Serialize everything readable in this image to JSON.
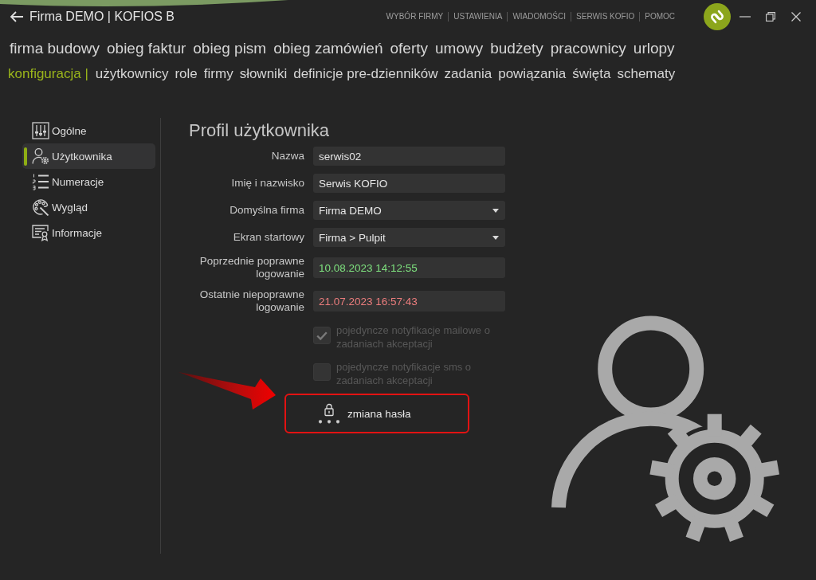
{
  "window": {
    "title": "Firma DEMO | KOFIOS B"
  },
  "top_links": [
    "WYBÓR FIRMY",
    "USTAWIENIA",
    "WIADOMOŚCI",
    "SERWIS KOFIO",
    "POMOC"
  ],
  "modules": [
    "firma budowy",
    "obieg faktur",
    "obieg pism",
    "obieg zamówień",
    "oferty",
    "umowy",
    "budżety",
    "pracownicy",
    "urlopy"
  ],
  "submenu": {
    "current": "konfiguracja |",
    "items": [
      "użytkownicy",
      "role",
      "firmy",
      "słowniki",
      "definicje pre-dzienników",
      "zadania",
      "powiązania",
      "święta",
      "schematy"
    ]
  },
  "sidebar": {
    "items": [
      {
        "label": "Ogólne",
        "selected": false
      },
      {
        "label": "Użytkownika",
        "selected": true
      },
      {
        "label": "Numeracje",
        "selected": false
      },
      {
        "label": "Wygląd",
        "selected": false
      },
      {
        "label": "Informacje",
        "selected": false
      }
    ]
  },
  "form": {
    "title": "Profil użytkownika",
    "fields": [
      {
        "label": "Nazwa",
        "value": "serwis02",
        "kind": "input"
      },
      {
        "label": "Imię i nazwisko",
        "value": "Serwis KOFIO",
        "kind": "input"
      },
      {
        "label": "Domyślna firma",
        "value": "Firma DEMO",
        "kind": "select"
      },
      {
        "label": "Ekran startowy",
        "value": "Firma > Pulpit",
        "kind": "select"
      },
      {
        "label": "Poprzednie poprawne logowanie",
        "value": "10.08.2023 14:12:55",
        "kind": "readonly",
        "color": "#7ee07e"
      },
      {
        "label": "Ostatnie niepoprawne logowanie",
        "value": "21.07.2023 16:57:43",
        "kind": "readonly",
        "color": "#ec7d7d"
      }
    ],
    "options": [
      {
        "label": "pojedyncze notyfikacje mailowe o zadaniach akceptacji",
        "checked": true,
        "disabled": true
      },
      {
        "label": "pojedyncze notyfikacje sms o zadaniach akceptacji",
        "checked": false,
        "disabled": true
      }
    ]
  },
  "password_button": {
    "label": "zmiana hasła",
    "highlighted": true,
    "pointed_at": true
  }
}
